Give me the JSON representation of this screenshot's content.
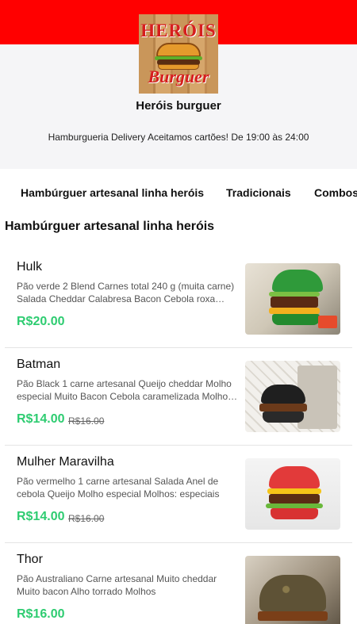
{
  "colors": {
    "brand_red": "#ff0000",
    "price_green": "#2ecc71"
  },
  "logo": {
    "top_text": "HERÓIS",
    "bottom_text": "Burguer",
    "icon": "burger-logo-icon"
  },
  "store": {
    "name": "Heróis burguer",
    "description": "Hamburgueria Delivery Aceitamos cartões! De 19:00 às 24:00"
  },
  "tabs": [
    {
      "label": "Hambúrguer artesanal linha heróis"
    },
    {
      "label": "Tradicionais"
    },
    {
      "label": "Combos"
    }
  ],
  "section": {
    "title": "Hambúrguer artesanal linha heróis"
  },
  "items": [
    {
      "name": "Hulk",
      "description": "Pão verde 2 Blend Carnes total 240 g (muita carne) Salada Cheddar Calabresa Bacon Cebola roxa caramelizada",
      "price": "R$20.00",
      "old_price": ""
    },
    {
      "name": "Batman",
      "description": "Pão Black 1 carne artesanal Queijo cheddar Molho especial Muito Bacon Cebola caramelizada Molhos especiais",
      "price": "R$14.00",
      "old_price": "R$16.00"
    },
    {
      "name": "Mulher Maravilha",
      "description": "Pão vermelho 1 carne artesanal Salada Anel de cebola Queijo Molho especial Molhos: especiais",
      "price": "R$14.00",
      "old_price": "R$16.00"
    },
    {
      "name": "Thor",
      "description": "Pão Australiano Carne artesanal Muito cheddar Muito bacon Alho torrado Molhos",
      "price": "R$16.00",
      "old_price": ""
    }
  ]
}
